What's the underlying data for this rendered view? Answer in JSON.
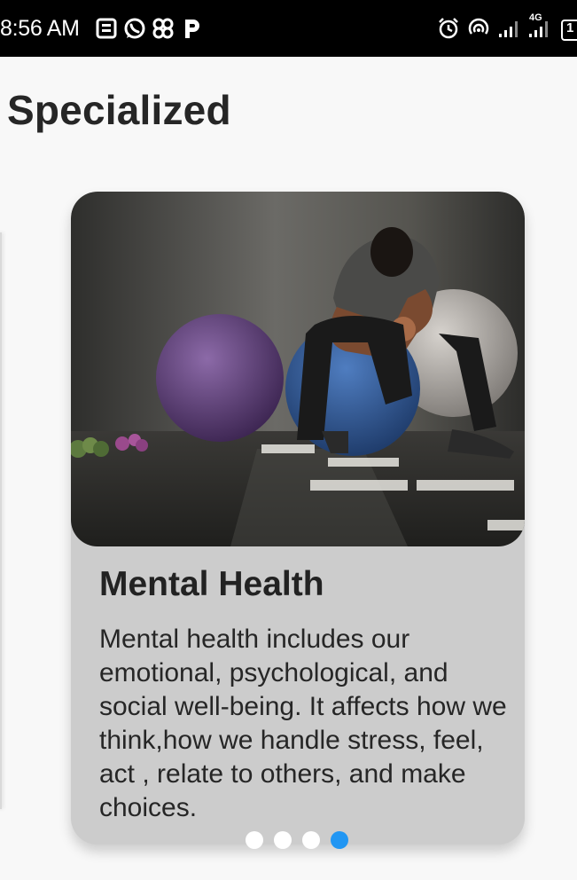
{
  "status_bar": {
    "time": "8:56 AM",
    "left_icons": [
      "news-icon",
      "whatsapp-icon",
      "pinwheel-icon",
      "p-app-icon"
    ],
    "right_icons": [
      "alarm-icon",
      "hotspot-icon",
      "signal-icon",
      "signal-4g-icon",
      "battery-icon"
    ],
    "network_label": "4G",
    "battery_label": "1"
  },
  "page": {
    "title": "Specialized"
  },
  "card": {
    "image_subject": "man sitting on exercise ball with head down",
    "title": "Mental Health",
    "description": "Mental health includes our emotional, psychological, and social well-being. It affects how we think,how we handle stress, feel, act , relate to others, and make choices."
  },
  "carousel": {
    "total": 4,
    "active_index": 3,
    "dot_color": "#ffffff",
    "active_color": "#2196f3"
  },
  "colors": {
    "background": "#f8f8f8",
    "card": "#cccccc",
    "status_bar": "#000000"
  }
}
